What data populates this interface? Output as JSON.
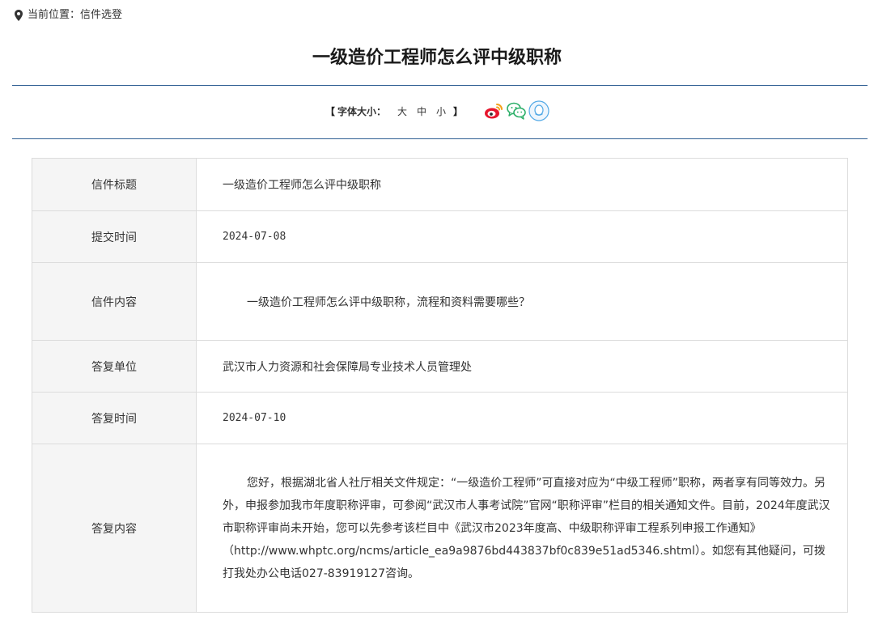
{
  "breadcrumb": {
    "label": "当前位置：",
    "current": "信件选登"
  },
  "title": "一级造价工程师怎么评中级职称",
  "toolbar": {
    "open_bracket": "【",
    "font_label": "字体大小：",
    "size_large": "大",
    "size_medium": "中",
    "size_small": "小",
    "close_bracket": "】",
    "share_icons": [
      "weibo-icon",
      "wechat-icon",
      "qq-icon"
    ]
  },
  "colors": {
    "rule": "#2f5f93",
    "key_bg": "#f5f5f5",
    "border": "#dcdcdc",
    "weibo": "#e6162d",
    "wechat": "#2aae67",
    "qq": "#52a9e6"
  },
  "letter": {
    "rows": [
      {
        "key": "信件标题",
        "value": "一级造价工程师怎么评中级职称"
      },
      {
        "key": "提交时间",
        "value": "2024-07-08"
      },
      {
        "key": "信件内容",
        "value": "一级造价工程师怎么评中级职称，流程和资料需要哪些？"
      },
      {
        "key": "答复单位",
        "value": "武汉市人力资源和社会保障局专业技术人员管理处"
      },
      {
        "key": "答复时间",
        "value": "2024-07-10"
      },
      {
        "key": "答复内容",
        "value": "您好，根据湖北省人社厅相关文件规定：“一级造价工程师”可直接对应为“中级工程师”职称，两者享有同等效力。另外，申报参加我市年度职称评审，可参阅“武汉市人事考试院”官网“职称评审”栏目的相关通知文件。目前，2024年度武汉市职称评审尚未开始，您可以先参考该栏目中《武汉市2023年度高、中级职称评审工程系列申报工作通知》（http://www.whptc.org/ncms/article_ea9a9876bd443837bf0c839e51ad5346.shtml）。如您有其他疑问，可拨打我处办公电话027-83919127咨询。"
      }
    ]
  }
}
